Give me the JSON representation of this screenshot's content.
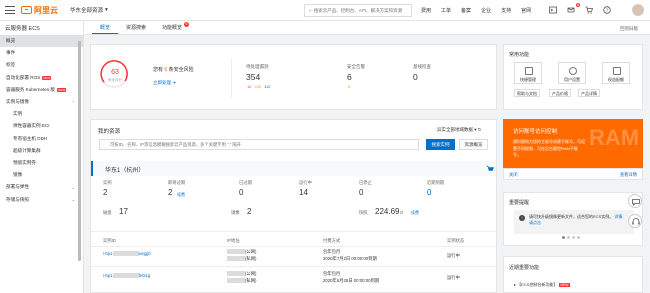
{
  "brand": {
    "name": "阿里云",
    "color": "#ff6a00"
  },
  "topbar": {
    "account": "华东全部资源",
    "search_placeholder": "搜索云产品、控制台、API、解决方案和资源",
    "links": [
      "费用",
      "工单",
      "备案",
      "企业",
      "支持",
      "官网"
    ],
    "msg_badge": "6"
  },
  "sidebar": {
    "title": "云服务器 ECS",
    "items": [
      {
        "label": "概览",
        "type": "item",
        "active": true
      },
      {
        "label": "事件",
        "type": "item"
      },
      {
        "label": "标签",
        "type": "item"
      },
      {
        "label": "自动化部署 ROS",
        "type": "item",
        "tag": "NEW"
      },
      {
        "label": "容器服务 Kubernetes 版",
        "type": "item",
        "tag": "NEW"
      },
      {
        "label": "实例与镜像",
        "type": "group"
      },
      {
        "label": "实例",
        "type": "sub"
      },
      {
        "label": "弹性容器实例 ECI",
        "type": "sub"
      },
      {
        "label": "专有宿主机 DDH",
        "type": "sub"
      },
      {
        "label": "超级计算集群",
        "type": "sub"
      },
      {
        "label": "预留实例券",
        "type": "sub"
      },
      {
        "label": "镜像",
        "type": "sub"
      },
      {
        "label": "部署与弹性",
        "type": "group"
      },
      {
        "label": "存储与快照",
        "type": "group"
      }
    ]
  },
  "tabs": [
    {
      "label": "概览",
      "active": true
    },
    {
      "label": "资源搜索"
    },
    {
      "label": "功能概览",
      "badge": "6"
    }
  ],
  "collapse_label": "回到旧版",
  "overview": {
    "score": "63",
    "score_label": "安全评分",
    "risk_prefix": "您有",
    "risk_count": "6",
    "risk_suffix": "条安全风险",
    "risk_link": "立即处理",
    "stats": [
      {
        "label": "待处理漏洞",
        "value": "354",
        "bars": [
          "12",
          "230",
          "112"
        ]
      },
      {
        "label": "安全告警",
        "value": "6",
        "bars": [
          "6"
        ]
      },
      {
        "label": "基线检查",
        "value": "0"
      }
    ]
  },
  "quick": {
    "title": "常用功能",
    "buttons": [
      "快捷管理",
      "用户设置",
      "权益配额"
    ],
    "links": [
      "帮助与文档",
      "产品价格",
      "产品详情"
    ]
  },
  "resources": {
    "title": "我的资源",
    "sort_label": "异实全部地域数据",
    "search_placeholder": "可按ID、名称、IP等信息模糊搜索云产品资源，多个关键字用 \",\" 隔开",
    "search_button": "搜索实例",
    "advanced_button": "资源概览",
    "region": "华东1（杭州）",
    "metrics_row1": [
      {
        "label": "实例",
        "value": "2"
      },
      {
        "label": "即将过期",
        "value": "2",
        "link": "续费"
      },
      {
        "label": "已过期",
        "value": "0"
      },
      {
        "label": "运行中",
        "value": "14"
      },
      {
        "label": "已停止",
        "value": "0"
      },
      {
        "label": "近期到期",
        "value": "0"
      }
    ],
    "metrics_row2": [
      {
        "label": "磁盘",
        "value": "17"
      },
      {
        "label": "镜像",
        "value": "2"
      },
      {
        "label": "快照",
        "value": "224.69",
        "unit": "G",
        "link": "续费"
      }
    ],
    "columns": [
      "实例ID",
      "IP地址",
      "付费方式",
      "实例状态"
    ],
    "rows": [
      {
        "id": "i-bp1",
        "id_tail": "wxjgj0",
        "ip": "(公网)",
        "ip2": "(私网)",
        "pay": "包年包月",
        "pay_time": "2020年7月2日 00:00:00到期",
        "status": "运行中"
      },
      {
        "id": "i-bp1",
        "id_tail": "fe0i1g",
        "ip": "(公网)",
        "ip2": "(私网)",
        "pay": "包年包月",
        "pay_time": "2020年6月28日 00:00:00到期",
        "status": "运行中"
      }
    ]
  },
  "promo": {
    "title": "访问账号访问控制",
    "desc": "随时随地为您的主账号创建子账号，可设置不同权限，可在后台管控RAM子账号。",
    "bg_text": "RAM",
    "left_link": "关闭",
    "right_link": "查看详情"
  },
  "notice": {
    "title": "重要提醒",
    "text": "请尽快升级镜像更新文件，适合您的ECS实例。",
    "link": "详情请点击"
  },
  "news": {
    "title": "近期重要功能",
    "item": "【ECS控制台新功能】",
    "tag": "NEW"
  }
}
